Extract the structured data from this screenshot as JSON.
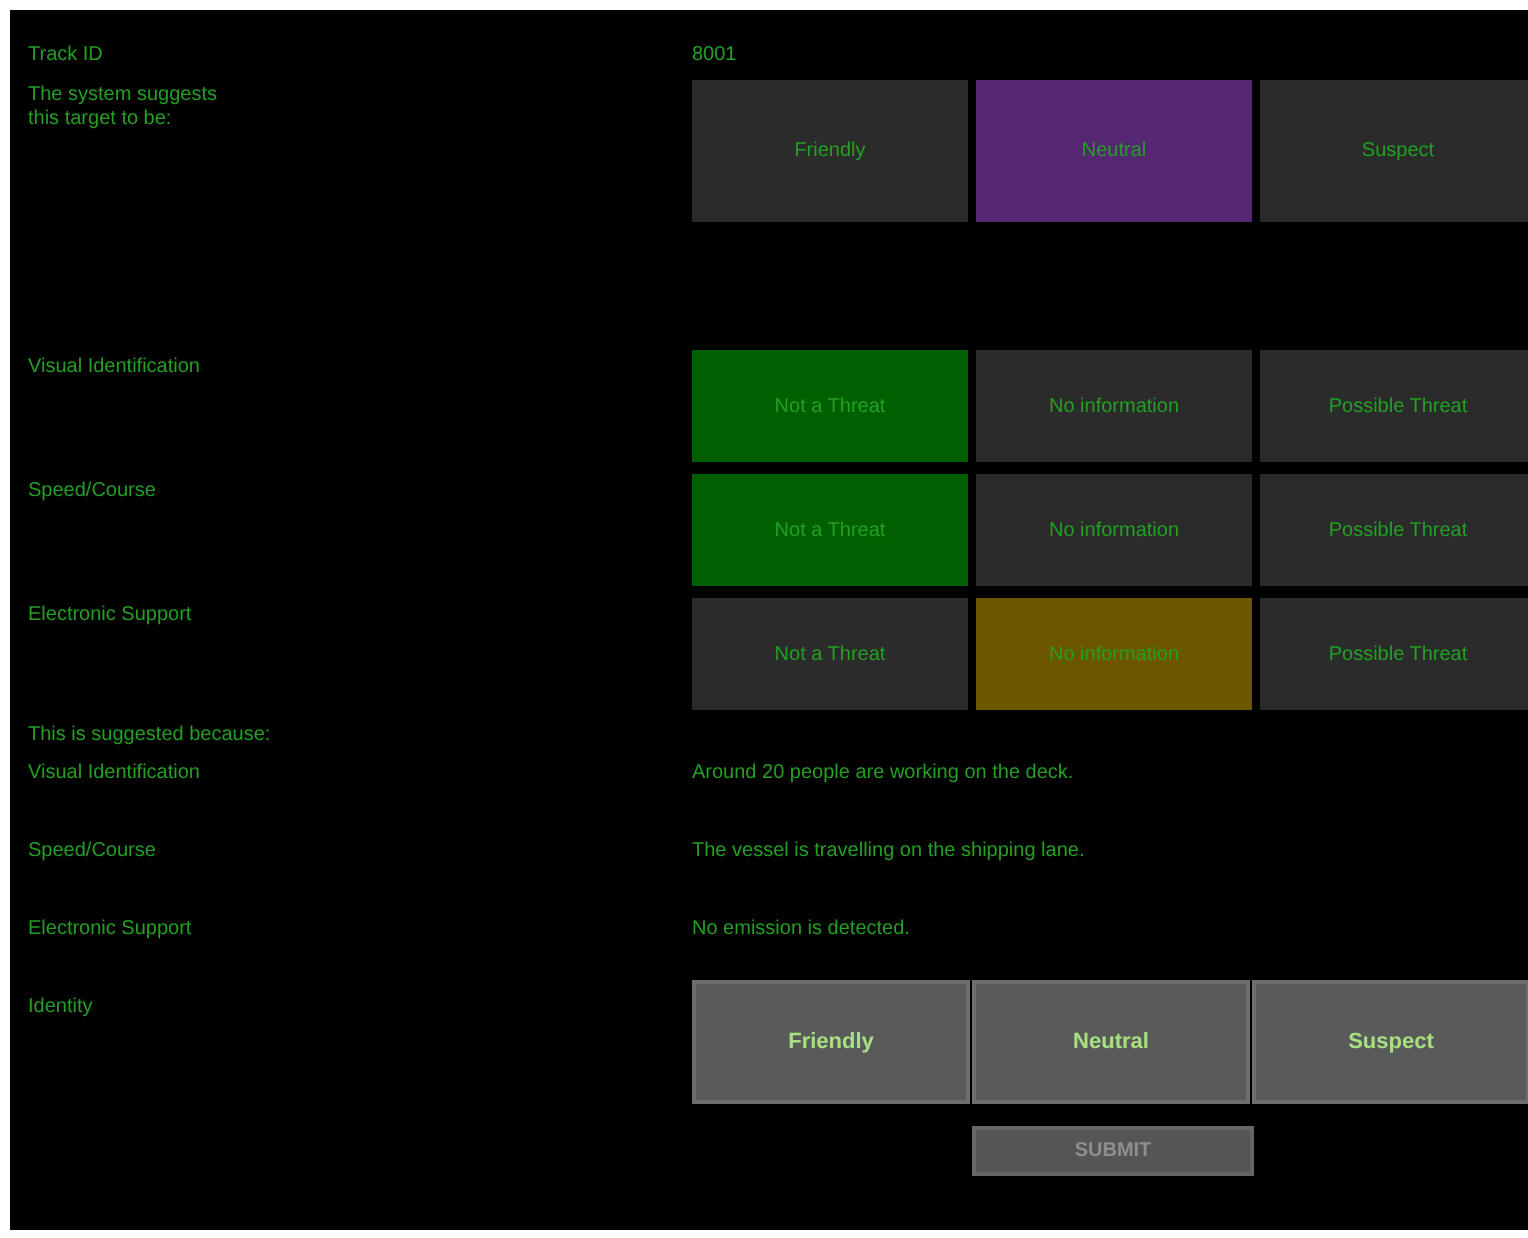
{
  "track_id": {
    "label": "Track ID",
    "value": "8001"
  },
  "suggestion": {
    "label": "The system suggests\nthis target to be:",
    "options": [
      {
        "label": "Friendly",
        "selected": false
      },
      {
        "label": "Neutral",
        "selected": true
      },
      {
        "label": "Suspect",
        "selected": false
      }
    ]
  },
  "assessments": [
    {
      "label": "Visual Identification",
      "options": [
        {
          "label": "Not a Threat",
          "selected": true
        },
        {
          "label": "No information",
          "selected": false
        },
        {
          "label": "Possible Threat",
          "selected": false
        }
      ]
    },
    {
      "label": "Speed/Course",
      "options": [
        {
          "label": "Not a Threat",
          "selected": true
        },
        {
          "label": "No information",
          "selected": false
        },
        {
          "label": "Possible Threat",
          "selected": false
        }
      ]
    },
    {
      "label": "Electronic Support",
      "options": [
        {
          "label": "Not a Threat",
          "selected": false
        },
        {
          "label": "No information",
          "selected": true
        },
        {
          "label": "Possible Threat",
          "selected": false
        }
      ]
    }
  ],
  "reasons": {
    "heading": "This is suggested because:",
    "items": [
      {
        "label": "Visual Identification",
        "text": "Around 20 people are working on the deck."
      },
      {
        "label": "Speed/Course",
        "text": "The vessel is travelling on the shipping lane."
      },
      {
        "label": "Electronic Support",
        "text": "No emission is detected."
      }
    ]
  },
  "identity": {
    "label": "Identity",
    "options": [
      {
        "label": "Friendly",
        "selected": false
      },
      {
        "label": "Neutral",
        "selected": false
      },
      {
        "label": "Suspect",
        "selected": false
      }
    ]
  },
  "submit": {
    "label": "SUBMIT",
    "disabled": true
  }
}
